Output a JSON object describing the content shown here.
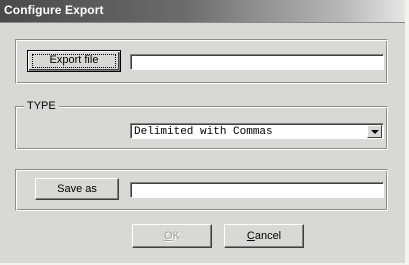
{
  "window": {
    "title": "Configure Export"
  },
  "export_group": {
    "export_button_label": "Export file",
    "path_value": ""
  },
  "type_group": {
    "legend": "TYPE",
    "selected_type": "Delimited with Commas"
  },
  "save_group": {
    "save_button_label": "Save as",
    "path_value": ""
  },
  "footer": {
    "ok_label_underlined": "O",
    "ok_label_rest": "K",
    "cancel_label_underlined": "C",
    "cancel_label_rest": "ancel"
  }
}
